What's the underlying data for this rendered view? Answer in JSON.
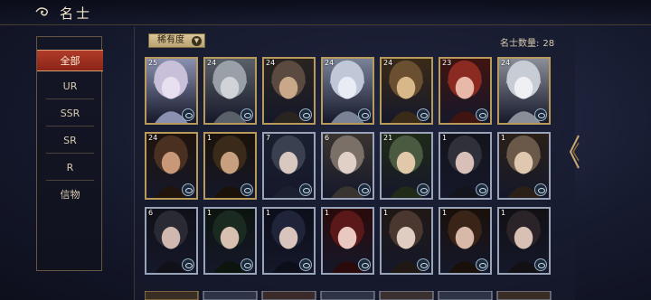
{
  "header": {
    "title": "名士"
  },
  "sidebar": {
    "items": [
      {
        "label": "全部",
        "active": true
      },
      {
        "label": "UR",
        "active": false
      },
      {
        "label": "SSR",
        "active": false
      },
      {
        "label": "SR",
        "active": false
      },
      {
        "label": "R",
        "active": false
      },
      {
        "label": "信物",
        "active": false
      }
    ]
  },
  "filter": {
    "label": "稀有度"
  },
  "roster": {
    "count_label": "名士数量:",
    "count_value": "28"
  },
  "cards": [
    {
      "level": "25",
      "frame": "gold"
    },
    {
      "level": "24",
      "frame": "gold"
    },
    {
      "level": "24",
      "frame": "gold"
    },
    {
      "level": "24",
      "frame": "gold"
    },
    {
      "level": "24",
      "frame": "gold"
    },
    {
      "level": "23",
      "frame": "gold"
    },
    {
      "level": "24",
      "frame": "gold"
    },
    {
      "level": "24",
      "frame": "gold"
    },
    {
      "level": "1",
      "frame": "gold"
    },
    {
      "level": "7",
      "frame": "silver"
    },
    {
      "level": "6",
      "frame": "silver"
    },
    {
      "level": "21",
      "frame": "silver"
    },
    {
      "level": "1",
      "frame": "silver"
    },
    {
      "level": "1",
      "frame": "silver"
    },
    {
      "level": "6",
      "frame": "silver"
    },
    {
      "level": "1",
      "frame": "silver"
    },
    {
      "level": "1",
      "frame": "silver"
    },
    {
      "level": "1",
      "frame": "silver"
    },
    {
      "level": "1",
      "frame": "silver"
    },
    {
      "level": "1",
      "frame": "silver"
    },
    {
      "level": "1",
      "frame": "silver"
    }
  ],
  "colors": {
    "accent_red": "#b03c2a",
    "frame_gold": "#b89a5a",
    "frame_silver": "#9aa4b8"
  }
}
